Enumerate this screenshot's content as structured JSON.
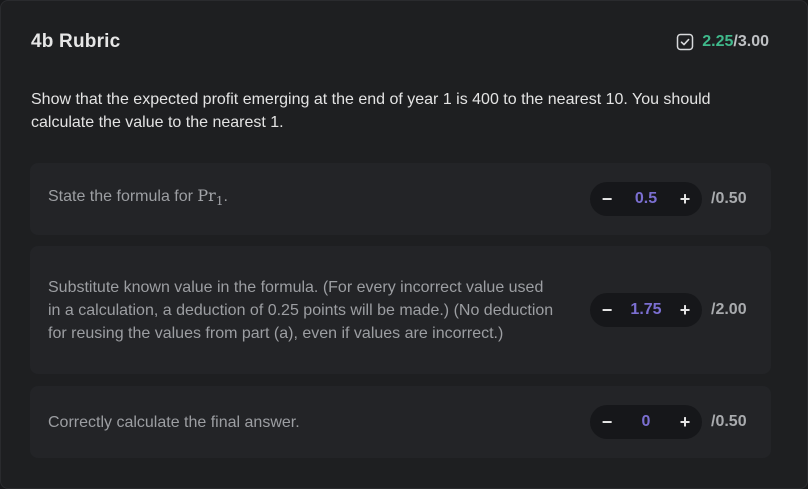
{
  "header": {
    "title": "4b Rubric",
    "score_earned": "2.25",
    "score_max": "/3.00",
    "check_icon": "checkbox-checked-icon"
  },
  "question": "Show that the expected profit emerging at the end of year 1 is 400 to the nearest 10. You should calculate the value to the nearest 1.",
  "rubric": {
    "items": [
      {
        "text_before": "State the formula for ",
        "math": "Pr",
        "math_sub": "1",
        "text_after": ".",
        "value": "0.5",
        "max": "/0.50"
      },
      {
        "text": "Substitute known value in the formula. (For every incorrect value used in a calculation, a deduction of 0.25 points will be made.) (No deduction for reusing the values from part (a), even if values are incorrect.)",
        "value": "1.75",
        "max": "/2.00"
      },
      {
        "text": "Correctly calculate the final answer.",
        "value": "0",
        "max": "/0.50"
      }
    ],
    "minus_label": "−",
    "plus_label": "+"
  },
  "colors": {
    "earned": "#3fb98b",
    "value": "#7b6fd1"
  }
}
